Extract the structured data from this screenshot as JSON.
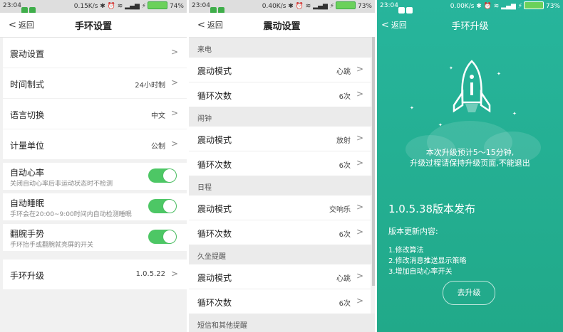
{
  "screen1": {
    "status": {
      "time": "23:04",
      "speed": "0.15K/s",
      "battery": "74%"
    },
    "back_label": "返回",
    "title": "手环设置",
    "items": [
      {
        "label": "震动设置",
        "value": ""
      },
      {
        "label": "时间制式",
        "value": "24小时制"
      },
      {
        "label": "语言切换",
        "value": "中文"
      },
      {
        "label": "计量单位",
        "value": "公制"
      }
    ],
    "toggles": [
      {
        "label": "自动心率",
        "desc": "关闭自动心率后非运动状态时不检测",
        "on": true
      },
      {
        "label": "自动睡眠",
        "desc": "手环会在20:00~9:00时间内自动检测睡眠",
        "on": true
      },
      {
        "label": "翻腕手势",
        "desc": "手环抬手或翻腕就亮屏的开关",
        "on": true
      }
    ],
    "upgrade": {
      "label": "手环升级",
      "value": "1.0.5.22"
    }
  },
  "screen2": {
    "status": {
      "time": "23:04",
      "speed": "0.40K/s",
      "battery": "73%"
    },
    "back_label": "返回",
    "title": "震动设置",
    "sections": [
      {
        "name": "来电",
        "mode_label": "震动模式",
        "mode_value": "心跳",
        "loop_label": "循环次数",
        "loop_value": "6次"
      },
      {
        "name": "闹钟",
        "mode_label": "震动模式",
        "mode_value": "放射",
        "loop_label": "循环次数",
        "loop_value": "6次"
      },
      {
        "name": "日程",
        "mode_label": "震动模式",
        "mode_value": "交响乐",
        "loop_label": "循环次数",
        "loop_value": "6次"
      },
      {
        "name": "久坐提醒",
        "mode_label": "震动模式",
        "mode_value": "心跳",
        "loop_label": "循环次数",
        "loop_value": "6次"
      }
    ],
    "last_section": "短信和其他提醒"
  },
  "screen3": {
    "status": {
      "time": "23:04",
      "speed": "0.00K/s",
      "battery": "73%"
    },
    "back_label": "返回",
    "title": "手环升级",
    "info_line1": "本次升级预计5～15分钟,",
    "info_line2": "升级过程请保持升级页面,不能退出",
    "version": "1.0.5.38版本发布",
    "notes_title": "版本更新内容:",
    "notes": [
      "1.修改算法",
      "2.修改消息推送显示策略",
      "3.增加自动心率开关"
    ],
    "button": "去升级"
  },
  "colors": {
    "accent_green": "#4dc765",
    "upgrade_bg": "#24af93"
  },
  "icons": {
    "back": "chevron-left-icon",
    "chevron": "chevron-right-icon",
    "rocket": "rocket-icon"
  }
}
